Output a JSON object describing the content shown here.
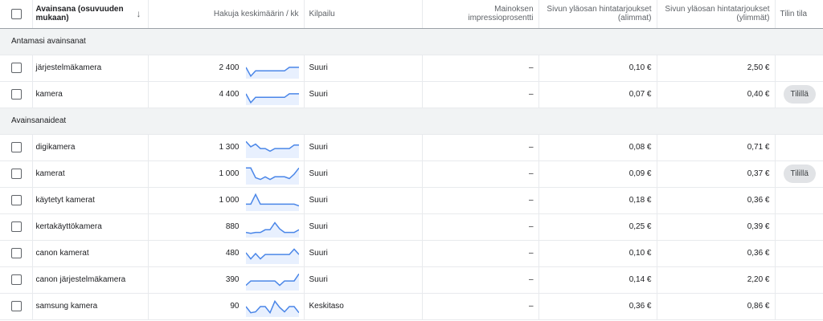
{
  "header": {
    "select_all": "",
    "keyword": "Avainsana (osuvuuden mukaan)",
    "avg_searches": "Hakuja keskimäärin / kk",
    "competition": "Kilpailu",
    "impression_share": "Mainoksen impressioprosentti",
    "bid_low": "Sivun yläosan hintatarjoukset (alimmat)",
    "bid_high": "Sivun yläosan hintatarjoukset (ylimmät)",
    "account_status": "Tilin tila"
  },
  "colors": {
    "spark_line": "#4a86e8",
    "spark_fill": "#e8f0fe",
    "group_bg": "#f1f3f4"
  },
  "groups": [
    {
      "label": "Antamasi avainsanat",
      "rows": [
        {
          "keyword": "järjestelmäkamera",
          "avg": "2 400",
          "trend": [
            0.55,
            0.05,
            0.35,
            0.35,
            0.35,
            0.35,
            0.35,
            0.35,
            0.35,
            0.55,
            0.55,
            0.55
          ],
          "competition": "Suuri",
          "impression": "–",
          "low": "0,10 €",
          "high": "2,50 €",
          "status": ""
        },
        {
          "keyword": "kamera",
          "avg": "4 400",
          "trend": [
            0.55,
            0.05,
            0.35,
            0.35,
            0.35,
            0.35,
            0.35,
            0.35,
            0.35,
            0.55,
            0.55,
            0.55
          ],
          "competition": "Suuri",
          "impression": "–",
          "low": "0,07 €",
          "high": "0,40 €",
          "status": "Tilillä"
        }
      ]
    },
    {
      "label": "Avainsanaideat",
      "rows": [
        {
          "keyword": "digikamera",
          "avg": "1 300",
          "trend": [
            0.85,
            0.55,
            0.7,
            0.45,
            0.45,
            0.3,
            0.45,
            0.45,
            0.45,
            0.45,
            0.65,
            0.65
          ],
          "competition": "Suuri",
          "impression": "–",
          "low": "0,08 €",
          "high": "0,71 €",
          "status": ""
        },
        {
          "keyword": "kamerat",
          "avg": "1 000",
          "trend": [
            0.85,
            0.85,
            0.3,
            0.2,
            0.35,
            0.2,
            0.35,
            0.35,
            0.35,
            0.25,
            0.5,
            0.85
          ],
          "competition": "Suuri",
          "impression": "–",
          "low": "0,09 €",
          "high": "0,37 €",
          "status": "Tilillä"
        },
        {
          "keyword": "käytetyt kamerat",
          "avg": "1 000",
          "trend": [
            0.3,
            0.3,
            0.85,
            0.3,
            0.3,
            0.3,
            0.3,
            0.3,
            0.3,
            0.3,
            0.3,
            0.2
          ],
          "competition": "Suuri",
          "impression": "–",
          "low": "0,18 €",
          "high": "0,36 €",
          "status": ""
        },
        {
          "keyword": "kertakäyttökamera",
          "avg": "880",
          "trend": [
            0.2,
            0.15,
            0.2,
            0.2,
            0.35,
            0.35,
            0.75,
            0.4,
            0.2,
            0.2,
            0.2,
            0.35
          ],
          "competition": "Suuri",
          "impression": "–",
          "low": "0,25 €",
          "high": "0,39 €",
          "status": ""
        },
        {
          "keyword": "canon kamerat",
          "avg": "480",
          "trend": [
            0.55,
            0.2,
            0.5,
            0.2,
            0.45,
            0.45,
            0.45,
            0.45,
            0.45,
            0.45,
            0.75,
            0.45
          ],
          "competition": "Suuri",
          "impression": "–",
          "low": "0,10 €",
          "high": "0,36 €",
          "status": ""
        },
        {
          "keyword": "canon järjestelmäkamera",
          "avg": "390",
          "trend": [
            0.2,
            0.45,
            0.45,
            0.45,
            0.45,
            0.45,
            0.45,
            0.2,
            0.45,
            0.45,
            0.45,
            0.85
          ],
          "competition": "Suuri",
          "impression": "–",
          "low": "0,14 €",
          "high": "2,20 €",
          "status": ""
        },
        {
          "keyword": "samsung kamera",
          "avg": "90",
          "trend": [
            0.5,
            0.15,
            0.2,
            0.5,
            0.5,
            0.15,
            0.8,
            0.45,
            0.2,
            0.5,
            0.5,
            0.15
          ],
          "competition": "Keskitaso",
          "impression": "–",
          "low": "0,36 €",
          "high": "0,86 €",
          "status": ""
        }
      ]
    }
  ]
}
